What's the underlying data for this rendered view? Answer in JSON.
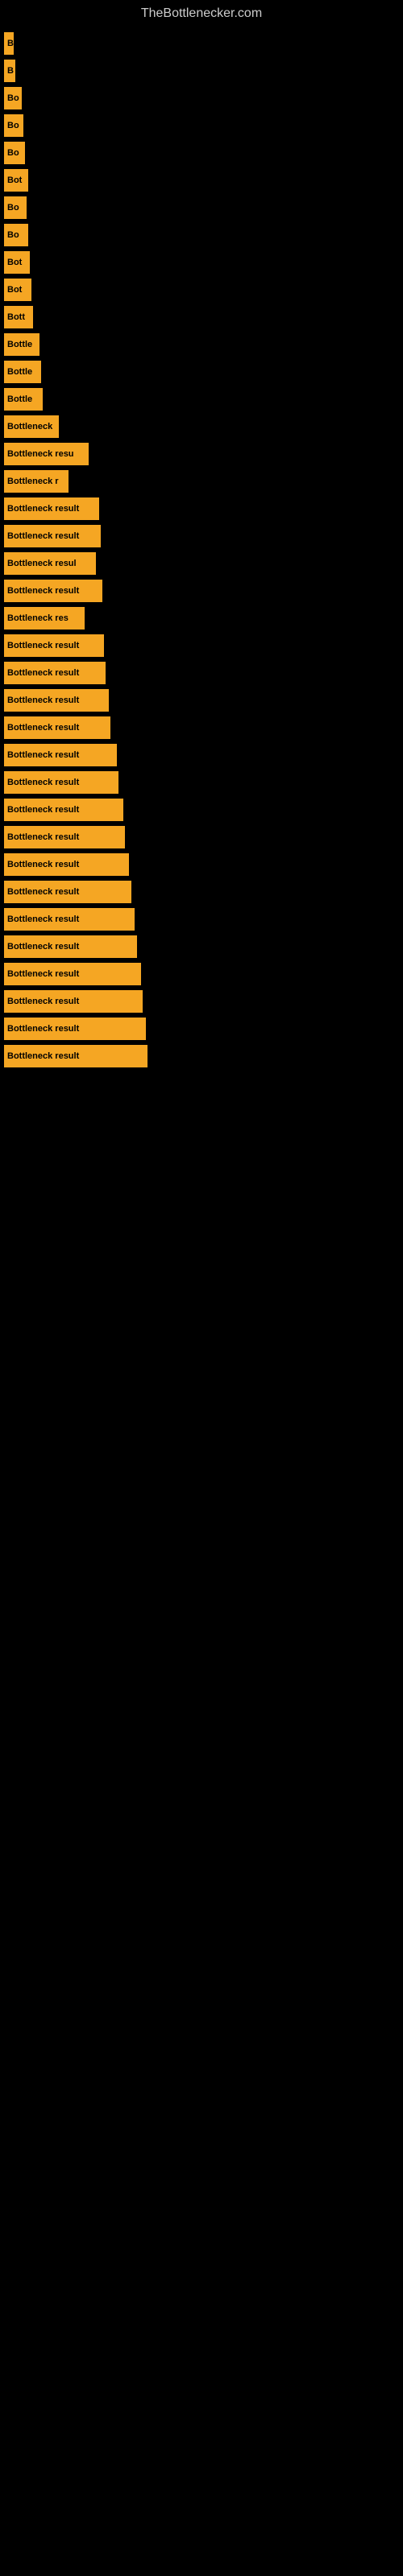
{
  "site": {
    "title": "TheBottlenecker.com"
  },
  "bars": [
    {
      "label": "B",
      "width": 12
    },
    {
      "label": "B",
      "width": 14
    },
    {
      "label": "Bo",
      "width": 22
    },
    {
      "label": "Bo",
      "width": 24
    },
    {
      "label": "Bo",
      "width": 26
    },
    {
      "label": "Bot",
      "width": 30
    },
    {
      "label": "Bo",
      "width": 28
    },
    {
      "label": "Bo",
      "width": 30
    },
    {
      "label": "Bot",
      "width": 32
    },
    {
      "label": "Bot",
      "width": 34
    },
    {
      "label": "Bott",
      "width": 36
    },
    {
      "label": "Bottle",
      "width": 44
    },
    {
      "label": "Bottle",
      "width": 46
    },
    {
      "label": "Bottle",
      "width": 48
    },
    {
      "label": "Bottleneck",
      "width": 68
    },
    {
      "label": "Bottleneck resu",
      "width": 105
    },
    {
      "label": "Bottleneck r",
      "width": 80
    },
    {
      "label": "Bottleneck result",
      "width": 118
    },
    {
      "label": "Bottleneck result",
      "width": 120
    },
    {
      "label": "Bottleneck resul",
      "width": 114
    },
    {
      "label": "Bottleneck result",
      "width": 122
    },
    {
      "label": "Bottleneck res",
      "width": 100
    },
    {
      "label": "Bottleneck result",
      "width": 124
    },
    {
      "label": "Bottleneck result",
      "width": 126
    },
    {
      "label": "Bottleneck result",
      "width": 130
    },
    {
      "label": "Bottleneck result",
      "width": 132
    },
    {
      "label": "Bottleneck result",
      "width": 140
    },
    {
      "label": "Bottleneck result",
      "width": 142
    },
    {
      "label": "Bottleneck result",
      "width": 148
    },
    {
      "label": "Bottleneck result",
      "width": 150
    },
    {
      "label": "Bottleneck result",
      "width": 155
    },
    {
      "label": "Bottleneck result",
      "width": 158
    },
    {
      "label": "Bottleneck result",
      "width": 162
    },
    {
      "label": "Bottleneck result",
      "width": 165
    },
    {
      "label": "Bottleneck result",
      "width": 170
    },
    {
      "label": "Bottleneck result",
      "width": 172
    },
    {
      "label": "Bottleneck result",
      "width": 176
    },
    {
      "label": "Bottleneck result",
      "width": 178
    }
  ]
}
